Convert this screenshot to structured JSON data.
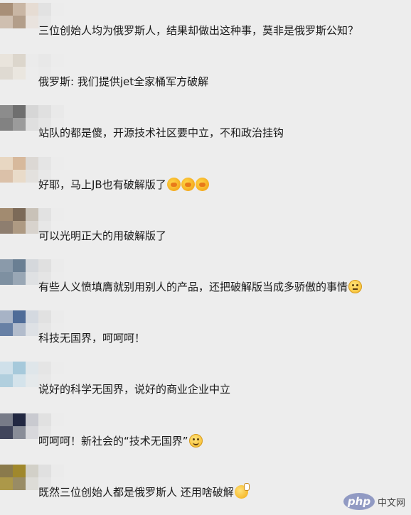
{
  "comments": [
    {
      "text": "三位创始人均为俄罗斯人，结果却做出这种事，莫非是俄罗斯公知？",
      "emoji": []
    },
    {
      "text": "俄罗斯: 我们提供jet全家桶军方破解",
      "emoji": []
    },
    {
      "text": "站队的都是傻，开源技术社区要中立，不和政治挂钩",
      "emoji": []
    },
    {
      "text": "好耶，马上JB也有破解版了",
      "emoji": [
        "facepalm-emoji",
        "facepalm-emoji",
        "facepalm-emoji"
      ]
    },
    {
      "text": "可以光明正大的用破解版了",
      "emoji": []
    },
    {
      "text": "有些人义愤填膺就别用别人的产品，还把破解版当成多骄傲的事情",
      "emoji": [
        "awkward-emoji"
      ]
    },
    {
      "text": "科技无国界，呵呵呵！",
      "emoji": []
    },
    {
      "text": "说好的科学无国界，说好的商业企业中立",
      "emoji": []
    },
    {
      "text": "呵呵呵！新社会的“技术无国界”",
      "emoji": [
        "smile-emoji"
      ]
    },
    {
      "text": "既然三位创始人都是俄罗斯人 还用啥破解",
      "emoji": [
        "shush-emoji"
      ]
    }
  ],
  "mosaic_colors": [
    [
      "#a88f78",
      "#c9b6a4",
      "#e6dcd3",
      "#e2e2e2",
      "#ececec"
    ],
    [
      "#e9e4dc",
      "#dcd6cc",
      "#ebebeb",
      "#e8e8e8",
      "#ececec"
    ],
    [
      "#8c8c8c",
      "#6f6f6f",
      "#d6d6d6",
      "#e0e0e0",
      "#e9e9e9"
    ],
    [
      "#e8d7c2",
      "#d7b99c",
      "#dcd8d4",
      "#e5e5e5",
      "#ececec"
    ],
    [
      "#a28b70",
      "#7c6a58",
      "#c9c2b8",
      "#e2e2e2",
      "#ececec"
    ],
    [
      "#8a9aaa",
      "#6a7f93",
      "#d5d8dc",
      "#e0e0e0",
      "#ebebeb"
    ],
    [
      "#a7b3c6",
      "#4f6c98",
      "#d4d9e0",
      "#e1e1e1",
      "#ebebeb"
    ],
    [
      "#cfe0ea",
      "#a6c9db",
      "#dfe6ea",
      "#e5e5e5",
      "#ececec"
    ],
    [
      "#777b88",
      "#222842",
      "#c9cad0",
      "#e1e1e1",
      "#ececec"
    ],
    [
      "#8a7a4c",
      "#a0882c",
      "#d2d0c8",
      "#e0e0e0",
      "#ebebeb"
    ]
  ],
  "watermark": {
    "logo": "php",
    "text": "中文网"
  }
}
